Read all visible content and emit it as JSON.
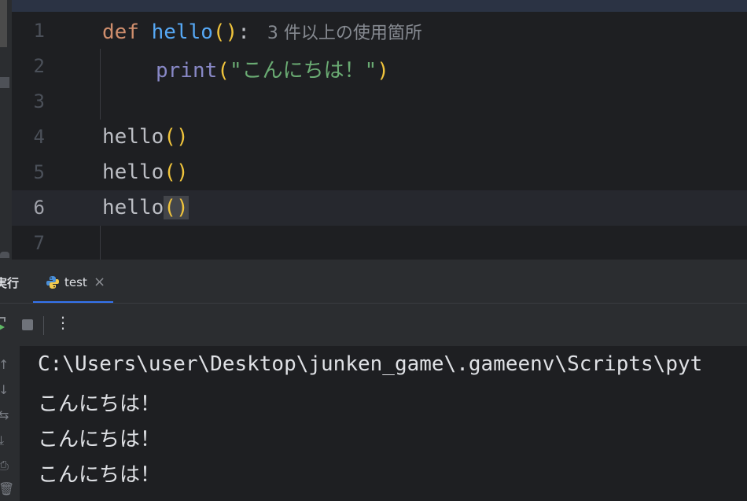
{
  "editor": {
    "lines": [
      {
        "number": "1",
        "kw": "def",
        "fn": "hello",
        "open": "(",
        "close": ")",
        "colon": ":",
        "usages": "3 件以上の使用箇所"
      },
      {
        "number": "2",
        "builtin": "print",
        "open": "(",
        "string": "\"こんにちは！\"",
        "close": ")"
      },
      {
        "number": "3"
      },
      {
        "number": "4",
        "name": "hello",
        "open": "(",
        "close": ")"
      },
      {
        "number": "5",
        "name": "hello",
        "open": "(",
        "close": ")"
      },
      {
        "number": "6",
        "name": "hello",
        "open": "(",
        "close": ")"
      },
      {
        "number": "7"
      }
    ]
  },
  "run_panel": {
    "title": "実行",
    "tab_label": "test",
    "close_glyph": "×",
    "more_glyph": "⋮"
  },
  "console": {
    "lines": [
      "C:\\Users\\user\\Desktop\\junken_game\\.gameenv\\Scripts\\pyt",
      "こんにちは！",
      "こんにちは！",
      "こんにちは！"
    ]
  },
  "side_icons": {
    "up": "↑",
    "down": "↓",
    "wrap": "⇆",
    "scroll_end": "⤓",
    "print": "⎙",
    "trash": "🗑"
  },
  "colors": {
    "keyword": "#cf8e6d",
    "function": "#56a8f5",
    "builtin": "#8888c6",
    "paren": "#f0c43c",
    "string": "#6aab73",
    "accent": "#3574f0"
  }
}
